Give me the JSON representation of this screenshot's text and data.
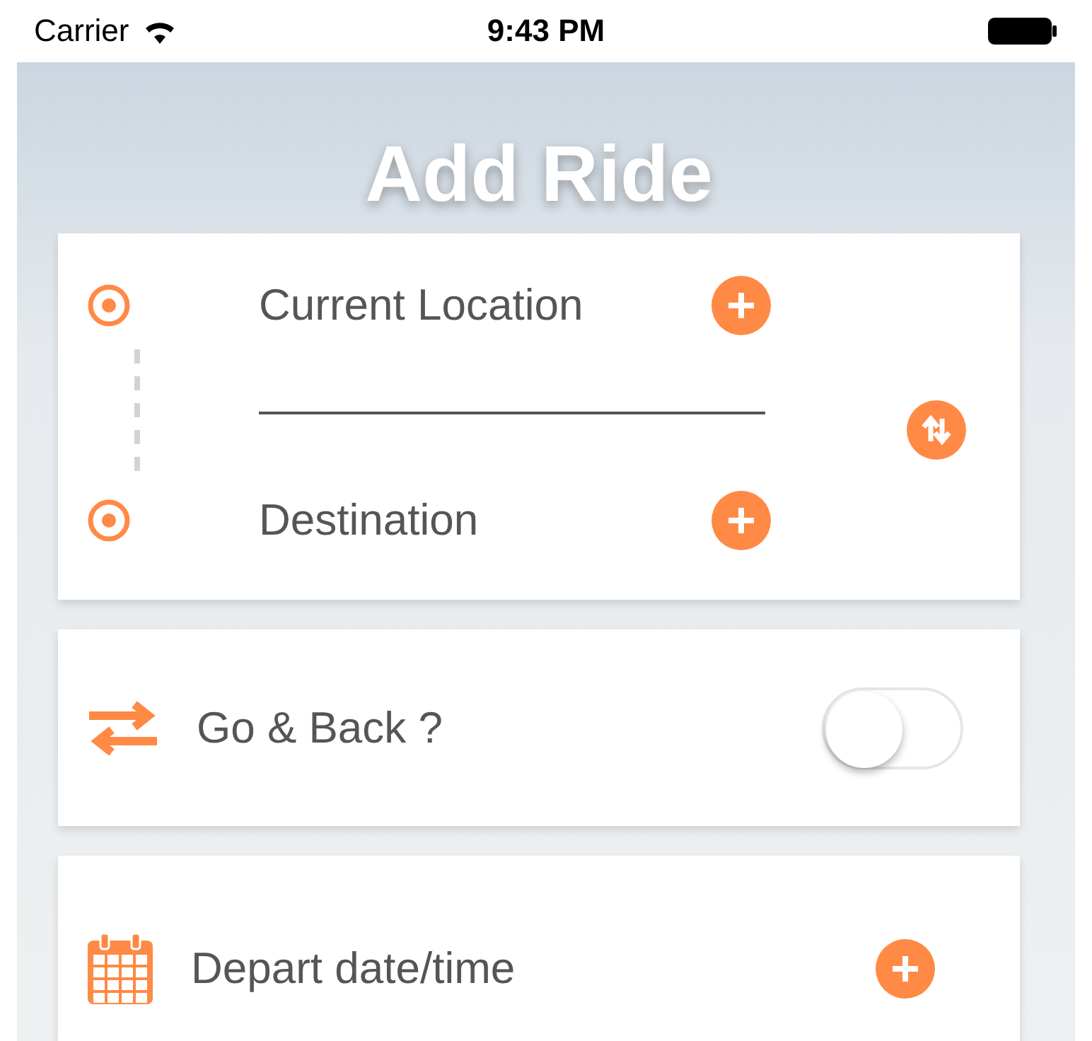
{
  "status_bar": {
    "carrier": "Carrier",
    "time": "9:43 PM"
  },
  "title": "Add Ride",
  "route": {
    "stops": [
      {
        "label": "Current Location"
      },
      {
        "label": "Destination"
      }
    ]
  },
  "round_trip": {
    "label": "Go & Back ?",
    "on": false
  },
  "departure": {
    "label": "Depart date/time"
  }
}
